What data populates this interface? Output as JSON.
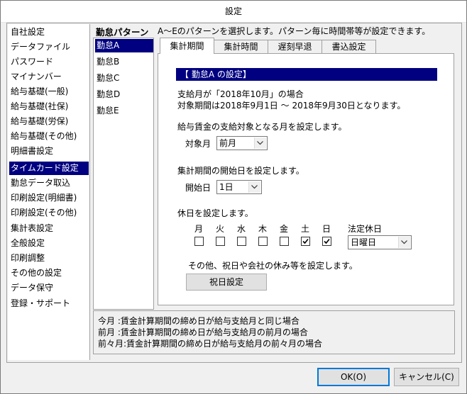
{
  "window": {
    "title": "設定"
  },
  "sidebar": {
    "items": [
      {
        "label": "自社設定",
        "selected": false
      },
      {
        "label": "データファイル",
        "selected": false
      },
      {
        "label": "パスワード",
        "selected": false
      },
      {
        "label": "マイナンバー",
        "selected": false
      },
      {
        "label": "給与基礎(一般)",
        "selected": false
      },
      {
        "label": "給与基礎(社保)",
        "selected": false
      },
      {
        "label": "給与基礎(労保)",
        "selected": false
      },
      {
        "label": "給与基礎(その他)",
        "selected": false
      },
      {
        "label": "明細書設定",
        "selected": false
      },
      {
        "label": "タイムカード設定",
        "selected": true
      },
      {
        "label": "勤怠データ取込",
        "selected": false
      },
      {
        "label": "印刷設定(明細書)",
        "selected": false
      },
      {
        "label": "印刷設定(その他)",
        "selected": false
      },
      {
        "label": "集計表設定",
        "selected": false
      },
      {
        "label": "全般設定",
        "selected": false
      },
      {
        "label": "印刷調整",
        "selected": false
      },
      {
        "label": "その他の設定",
        "selected": false
      },
      {
        "label": "データ保守",
        "selected": false
      },
      {
        "label": "登録・サポート",
        "selected": false
      }
    ]
  },
  "pattern": {
    "header": "勤怠パターン",
    "description": "A～Eのパターンを選択します。パターン毎に時間帯等が設定できます。",
    "items": [
      {
        "label": "勤怠A",
        "selected": true
      },
      {
        "label": "勤怠B",
        "selected": false
      },
      {
        "label": "勤怠C",
        "selected": false
      },
      {
        "label": "勤怠D",
        "selected": false
      },
      {
        "label": "勤怠E",
        "selected": false
      }
    ]
  },
  "tabs": [
    {
      "label": "集計期間",
      "active": true
    },
    {
      "label": "集計時間",
      "active": false
    },
    {
      "label": "遅刻早退",
      "active": false
    },
    {
      "label": "書込設定",
      "active": false
    }
  ],
  "panel": {
    "section_title": "【 勤怠A の設定】",
    "info_line1": "支給月が「2018年10月」の場合",
    "info_line2": "対象期間は2018年9月1日 ～ 2018年9月30日となります。",
    "month_prompt": "給与賃金の支給対象となる月を設定します。",
    "month_label": "対象月",
    "month_value": "前月",
    "startday_prompt": "集計期間の開始日を設定します。",
    "startday_label": "開始日",
    "startday_value": "1日",
    "holiday_prompt": "休日を設定します。",
    "weekdays": [
      {
        "label": "月",
        "checked": false
      },
      {
        "label": "火",
        "checked": false
      },
      {
        "label": "水",
        "checked": false
      },
      {
        "label": "木",
        "checked": false
      },
      {
        "label": "金",
        "checked": false
      },
      {
        "label": "土",
        "checked": true
      },
      {
        "label": "日",
        "checked": true
      }
    ],
    "legal_holiday_label": "法定休日",
    "legal_holiday_value": "日曜日",
    "other_prompt": "その他、祝日や会社の休み等を設定します。",
    "holiday_button": "祝日設定"
  },
  "notes": [
    "今月 :賃金計算期間の締め日が給与支給月と同じ場合",
    "前月 :賃金計算期間の締め日が給与支給月の前月の場合",
    "前々月:賃金計算期間の締め日が給与支給月の前々月の場合"
  ],
  "footer": {
    "ok": "OK(O)",
    "cancel": "キャンセル(C)"
  },
  "colors": {
    "selection": "#000080",
    "dialog_bg": "#f0f0f0",
    "default_button_border": "#0078d7"
  },
  "icons": {
    "combo": "chevron-down-icon",
    "checkbox": "check-icon"
  }
}
